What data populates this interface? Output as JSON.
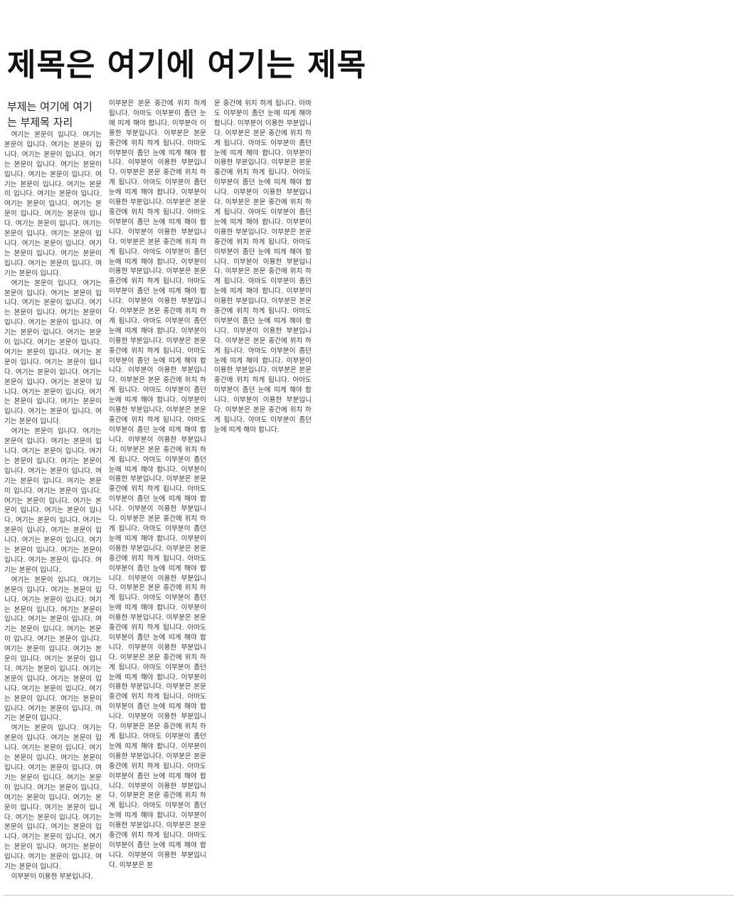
{
  "title": "제목은 여기에 여기는 제목",
  "subtitle": "부제는 여기에 여기는 부제목 자리",
  "column1": {
    "paragraphs": [
      "여기는 본문이 입니다. 여기는 본문이 입니다. 여기는 본문이 입니다. 여기는 본문이 입니다. 여기는 본문이 입니다. 여기는 본문이 입니다. 여기는 본문이 입니다. 여기는 본문이 입니다. 여기는 본문이 입니다. 여기는 본문이 입니다. 여기는 본문이 입니다. 여기는 본문이 입니다. 여기는 본문이 입니다. 여기는 본문이 입니다. 여기는 본문이 입니다. 여기는 본문이 입니다. 여기는 본문이 입니다. 여기는 본문이 입니다. 여기는 본문이 입니다. 여기는 본문이 입니다. 여기는 본문이 입니다.",
      "여기는 본문이 입니다. 여기는 본문이 입니다. 여기는 본문이 입니다. 여기는 본문이 입니다. 여기는 본문이 입니다. 여기는 본문이 입니다. 여기는 본문이 입니다. 여기는 본문이 입니다. 여기는 본문이 입니다. 여기는 본문이 입니다. 여기는 본문이 입니다. 여기는 본문이 입니다. 여기는 본문이 입니다. 여기는 본문이 입니다. 여기는 본문이 입니다. 여기는 본문이 입니다. 여기는 본문이 입니다. 여기는 본문이 입니다. 여기는 본문이 입니다. 여기는 본문이 입니다. 여기는 본문이 입니다.",
      "여기는 본문이 입니다. 여기는 본문이 입니다. 여기는 본문이 입니다. 여기는 본문이 입니다. 여기는 본문이 입니다. 여기는 본문이 입니다. 여기는 본문이 입니다. 여기는 본문이 입니다. 여기는 본문이 입니다. 여기는 본문이 입니다. 여기는 본문이 입니다. 여기는 본문이 입니다. 여기는 본문이 입니다. 여기는 본문이 입니다. 여기는 본문이 입니다. 여기는 본문이 입니다. 여기는 본문이 입니다. 여기는 본문이 입니다. 여기는 본문이 입니다. 여기는 본문이 입니다. 여기는 본문이 입니다.",
      "여기는 본문이 입니다. 여기는 본문이 입니다. 여기는 본문이 입니다. 여기는 본문이 입니다. 여기는 본문이 입니다. 여기는 본문이 입니다. 여기는 본문이 입니다. 여기는 본문이 입니다. 여기는 본문이 입니다. 여기는 본문이 입니다. 여기는 본문이 입니다. 여기는 본문이 입니다. 여기는 본문이 입니다. 여기는 본문이 입니다. 여기는 본문이 입니다. 여기는 본문이 입니다. 여기는 본문이 입니다. 여기는 본문이 입니다. 여기는 본문이 입니다. 여기는 본문이 입니다. 여기는 본문이 입니다.",
      "여기는 본문이 입니다. 여기는 본문이 입니다. 여기는 본문이 입니다. 여기는 본문이 입니다. 여기는 본문이 입니다. 여기는 본문이 입니다. 여기는 본문이 입니다. 여기는 본문이 입니다. 여기는 본문이 입니다. 여기는 본문이 입니다. 여기는 본문이 입니다. 여기는 본문이 입니다. 여기는 본문이 입니다. 여기는 본문이 입니다. 여기는 본문이 입니다. 여기는 본문이 입니다. 여기는 본문이 입니다. 여기는 본문이 입니다. 여기는 본문이 입니다. 여기는 본문이 입니다. 여기는 본문이 입니다.",
      "이부분이 이용한 부분입니다."
    ]
  },
  "column2": {
    "text": "이부분은 본문 중간에 위치 하게 됩니다. 아마도 이부분이 좀던 눈에 띠게 해야 합니다. 이부분이 이용한 부분입니다. 이부분은 본문 중간에 위치 하게 됩니다. 아마도 이부분이 좀던 눈에 띠게 해야 합니다. 이부분이 이용한 부분입니다. 이부분은 본문 중간에 위치 하게 됩니다. 아마도 이부분이 좀던 눈에 띠게 해야 합니다. 이부분이 이용한 부분입니다. 이부분은 본문 중간에 위치 하게 됩니다. 아마도 이부분이 좀던 눈에 띠게 해야 합니다. 이부분이 이용한 부분입니다. 이부분은 본문 중간에 위치 하게 됩니다. 아마도 이부분이 좀던 눈에 띠게 해야 합니다. 이부분이 이용한 부분입니다. 이부분은 본문 중간에 위치 하게 됩니다. 아마도 이부분이 좀던 눈에 띠게 해야 합니다. 이부분이 이용한 부분입니다. 이부분은 본문 중간에 위치 하게 됩니다. 아마도 이부분이 좀던 눈에 띠게 해야 합니다. 이부분이 이용한 부분입니다. 이부분은 본문 중간에 위치 하게 됩니다. 아마도 이부분이 좀던 눈에 띠게 해야 합니다. 이부분이 이용한 부분입니다. 이부분은 본문 중간에 위치 하게 됩니다. 아마도 이부분이 좀던 눈에 띠게 해야 합니다. 이부분이 이용한 부분입니다. 이부분은 본문 중간에 위치 하게 됩니다. 아마도 이부분이 좀던 눈에 띠게 해야 합니다. 이부분이 이용한 부분입니다. 이부분은 본문 중간에 위치 하게 됩니다. 아마도 이부분이 좀던 눈에 띠게 해야 합니다. 이부분이 이용한 부분입니다. 이부분은 본문 중간에 위치 하게 됩니다. 아마도 이부분이 좀던 눈에 띠게 해야 합니다. 이부분이 이용한 부분입니다. 이부분은 본문 중간에 위치 하게 됩니다. 아마도 이부분이 좀던 눈에 띠게 해야 합니다. 이부분이 이용한 부분입니다. 이부분은 본문 중간에 위치 하게 됩니다. 아마도 이부분이 좀던 눈에 띠게 해야 합니다. 이부분이 이용한 부분입니다. 이부분은 본문 중간에 위치 하게 됩니다. 아마도 이부분이 좀던 눈에 띠게 해야 합니다. 이부분이 이용한 부분입니다. 이부분은 본문 중간에 위치 하게 됩니다. 아마도 이부분이 좀던 눈에 띠게 해야 합니다. 이부분이 이용한 부분입니다. 이부분은 본문 중간에 위치 하게 됩니다. 아마도 이부분이 좀던 눈에 띠게 해야 합니다. 이부분이 이용한 부분입니다. 이부분은 본문 중간에 위치 하게 됩니다. 아마도 이부분이 좀던 눈에 띠게 해야 합니다. 이부분이 이용한 부분입니다. 이부분은 본문 중간에 위치 하게 됩니다. 아마도 이부분이 좀던 눈에 띠게 해야 합니다. 이부분이 이용한 부분입니다. 이부분은 본문 중간에 위치 하게 됩니다. 아마도 이부분이 좀던 눈에 띠게 해야 합니다. 이부분이 이용한 부분입니다. 이부분은 본문 중간에 위치 하게 됩니다. 아마도 이부분이 좀던 눈에 띠게 해야 합니다. 이부분이 이용한 부분입니다. 이부분은 본문 중간에 위치 하게 됩니다. 아마도 이부분이 좀던 눈에 띠게 해야 합니다. 이부분이 이용한 부분입니다. 이부분은 본"
  },
  "column3": {
    "text": "문 중간에 위치 하게 됩니다. 아마도 이부분이 좀던 눈에 띠게 해야 합니다. 이부분이 이용한 부분입니다. 이부분은 본문 중간에 위치 하게 됩니다. 아마도 이부분이 좀던 눈에 띠게 해야 합니다. 이부분이 이용한 부분입니다. 이부분은 본문 중간에 위치 하게 됩니다. 아마도 이부분이 좀던 눈에 띠게 해야 합니다. 이부분이 이용한 부분입니다. 이부분은 본문 중간에 위치 하게 됩니다. 아마도 이부분이 좀던 눈에 띠게 해야 합니다. 이부분이 이용한 부분입니다. 이부분은 본문 중간에 위치 하게 됩니다. 아마도 이부분이 좀던 눈에 띠게 해야 합니다. 이부분이 이용한 부분입니다. 이부분은 본문 중간에 위치 하게 됩니다. 아마도 이부분이 좀던 눈에 띠게 해야 합니다. 이부분이 이용한 부분입니다. 이부분은 본문 중간에 위치 하게 됩니다. 아마도 이부분이 좀던 눈에 띠게 해야 합니다. 이부분이 이용한 부분입니다. 이부분은 본문 중간에 위치 하게 됩니다. 아마도 이부분이 좀던 눈에 띠게 해야 합니다. 이부분이 이용한 부분입니다. 이부분은 본문 중간에 위치 하게 됩니다. 아마도 이부분이 좀던 눈에 띠게 해야 합니다. 이부분이 이용한 부분입니다. 이부분은 본문 중간에 위치 하게 됩니다. 아마도 이부분이 좀던 눈에 띠게 해야 합니다."
  }
}
